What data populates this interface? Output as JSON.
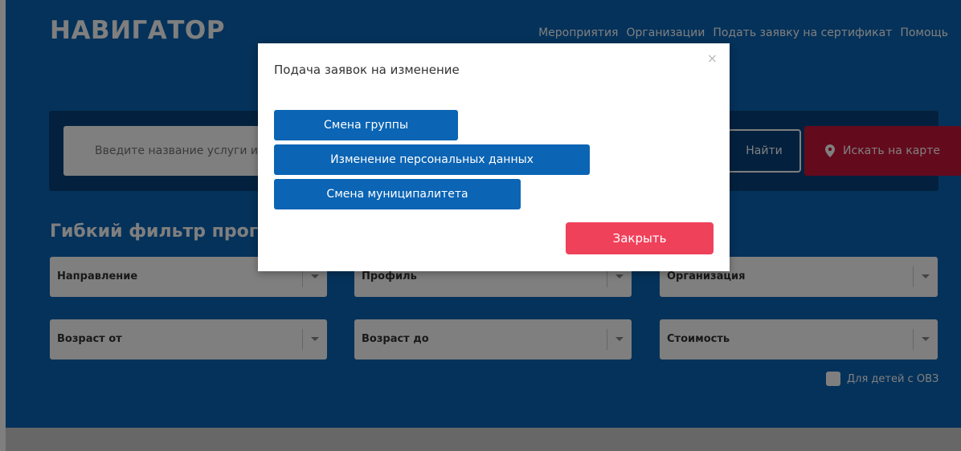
{
  "header": {
    "logo": "НАВИГАТОР",
    "nav": [
      "Мероприятия",
      "Организации",
      "Подать заявку на сертификат",
      "Помощь"
    ]
  },
  "search": {
    "placeholder": "Введите название услуги или организации",
    "find_label": "Найти",
    "map_label": "Искать на карте",
    "map_icon": "map-marker-icon"
  },
  "filters": {
    "title": "Гибкий фильтр программ",
    "selects": [
      "Направление",
      "Профиль",
      "Организация",
      "Возраст от",
      "Возраст до",
      "Стоимость"
    ],
    "ovz_label": "Для детей с ОВЗ",
    "ovz_checked": false
  },
  "modal": {
    "title": "Подача заявок на изменение",
    "close_icon": "×",
    "buttons": [
      "Смена группы",
      "Изменение персональных данных",
      "Смена муниципалитета"
    ],
    "close_label": "Закрыть"
  },
  "colors": {
    "brand_blue": "#0b64b4",
    "panel_dark": "#07427c",
    "map_red": "#c8143a",
    "close_red": "#f0415b"
  }
}
